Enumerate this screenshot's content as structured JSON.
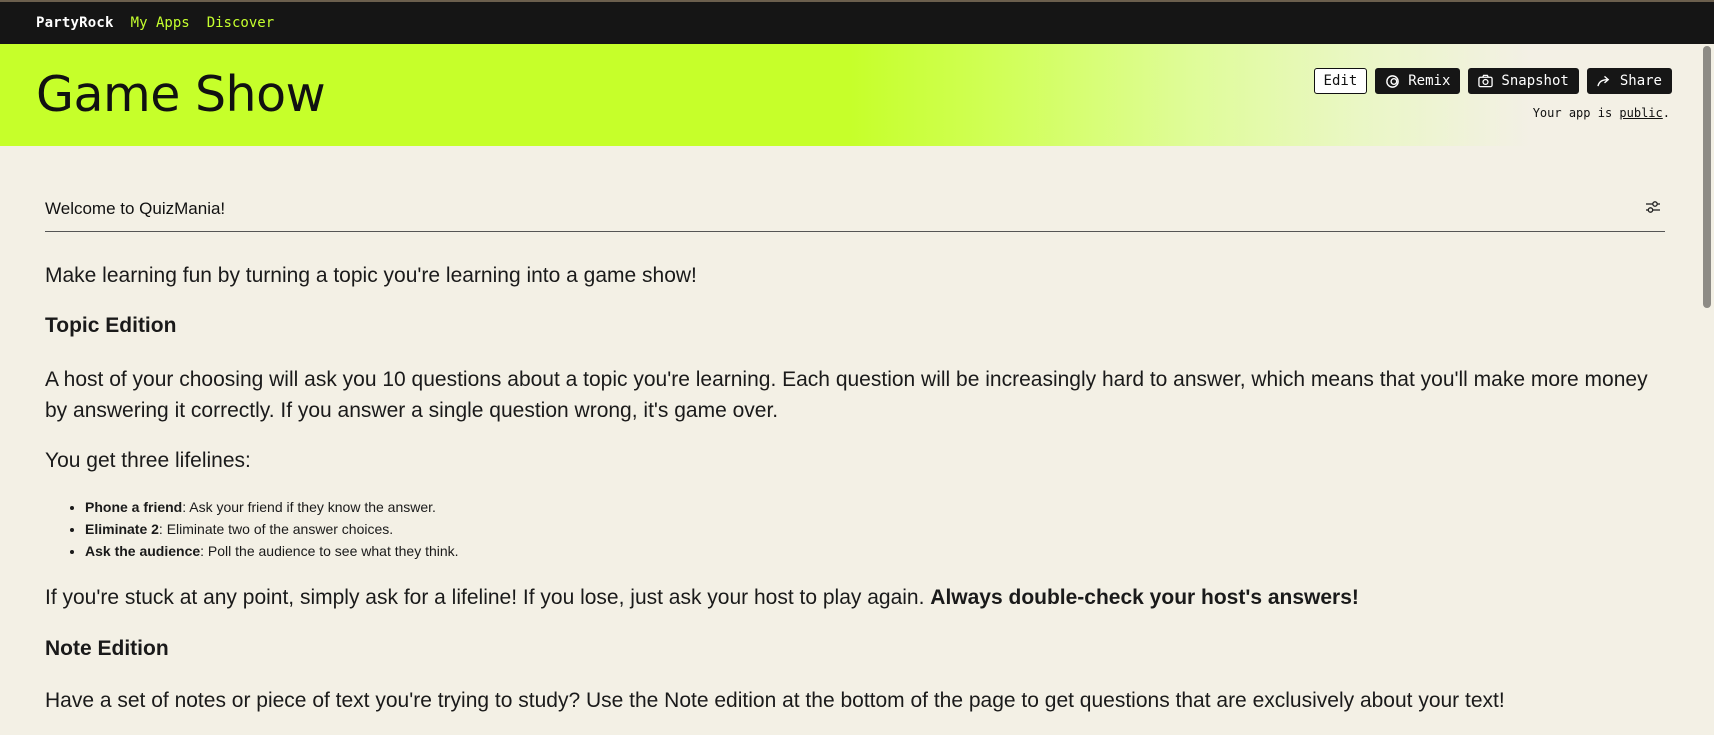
{
  "topbar": {
    "brand": "PartyRock",
    "nav": [
      "My Apps",
      "Discover"
    ]
  },
  "header": {
    "title": "Game Show",
    "buttons": {
      "edit": "Edit",
      "remix": "Remix",
      "snapshot": "Snapshot",
      "share": "Share"
    },
    "visibility_prefix": "Your app is ",
    "visibility_link": "public",
    "visibility_suffix": "."
  },
  "widget": {
    "title": "Welcome to QuizMania!",
    "intro": "Make learning fun by turning a topic you're learning into a game show!",
    "topic_heading": "Topic Edition",
    "topic_body": "A host of your choosing will ask you 10 questions about a topic you're learning. Each question will be increasingly hard to answer, which means that you'll make more money by answering it correctly. If you answer a single question wrong, it's game over.",
    "lifelines_intro": "You get three lifelines:",
    "lifelines": [
      {
        "name": "Phone a friend",
        "desc": ": Ask your friend if they know the answer."
      },
      {
        "name": "Eliminate 2",
        "desc": ": Eliminate two of the answer choices."
      },
      {
        "name": "Ask the audience",
        "desc": ": Poll the audience to see what they think."
      }
    ],
    "stuck_text": "If you're stuck at any point, simply ask for a lifeline! If you lose, just ask your host to play again. ",
    "stuck_bold": "Always double-check your host's answers!",
    "note_heading": "Note Edition",
    "note_body": "Have a set of notes or piece of text you're trying to study? Use the Note edition at the bottom of the page to get questions that are exclusively about your text!"
  },
  "colors": {
    "accent": "#c6ff2a",
    "topbar": "#151515",
    "background": "#f3f0e5"
  },
  "icons": [
    "remix-icon",
    "camera-icon",
    "share-arrow-icon",
    "sliders-icon"
  ]
}
